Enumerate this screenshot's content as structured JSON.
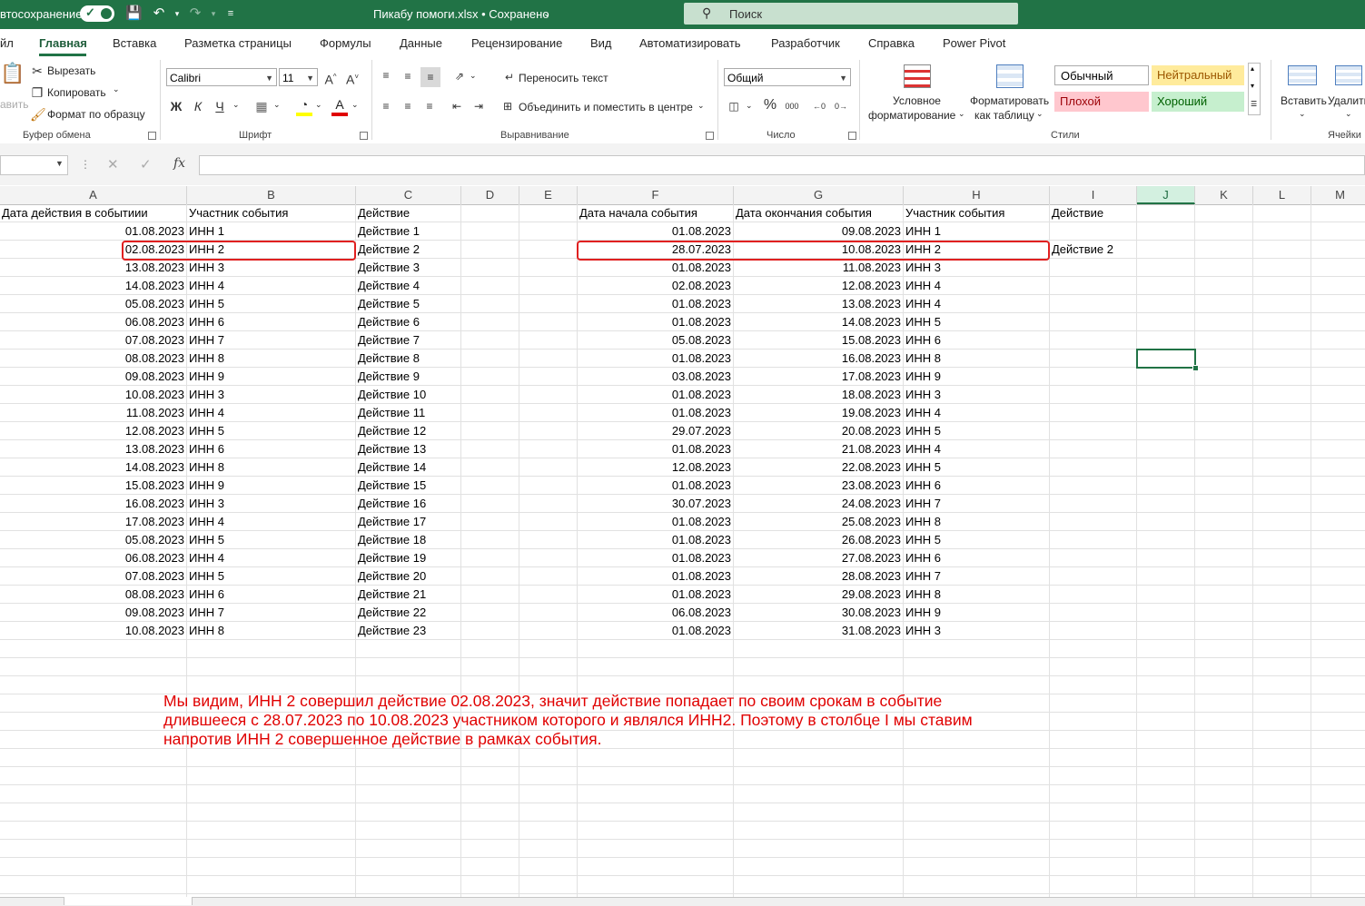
{
  "title_bar": {
    "autosave_label": "втосохранение",
    "file_title": "Пикабу помоги.xlsx • Сохранено",
    "search_placeholder": "Поиск"
  },
  "tabs": [
    "йл",
    "Главная",
    "Вставка",
    "Разметка страницы",
    "Формулы",
    "Данные",
    "Рецензирование",
    "Вид",
    "Автоматизировать",
    "Разработчик",
    "Справка",
    "Power Pivot"
  ],
  "ribbon": {
    "clipboard": {
      "cut": "Вырезать",
      "copy": "Копировать",
      "format_painter": "Формат по образцу",
      "paste_partial": "авить",
      "label": "Буфер обмена"
    },
    "font": {
      "name": "Calibri",
      "size": "11",
      "bold": "Ж",
      "italic": "К",
      "underline": "Ч",
      "label": "Шрифт"
    },
    "alignment": {
      "wrap": "Переносить текст",
      "merge": "Объединить и поместить в центре",
      "label": "Выравнивание"
    },
    "number": {
      "format": "Общий",
      "label": "Число"
    },
    "styles": {
      "conditional": [
        "Условное",
        "форматирование"
      ],
      "as_table": [
        "Форматировать",
        "как таблицу"
      ],
      "normal": "Обычный",
      "neutral": "Нейтральный",
      "bad": "Плохой",
      "good": "Хороший",
      "label": "Стили"
    },
    "cells": {
      "insert": "Вставить",
      "delete": "Удалить",
      "label": "Ячейки"
    }
  },
  "formula_bar": {
    "fx": "fx",
    "value": ""
  },
  "columns": [
    "A",
    "B",
    "C",
    "D",
    "E",
    "F",
    "G",
    "H",
    "I",
    "J",
    "K",
    "L",
    "M"
  ],
  "selected_column": "J",
  "sheet": {
    "headers": {
      "A": "Дата действия в событиии",
      "B": "Участник события",
      "C": "Действие",
      "F": "Дата начала события",
      "G": "Дата окончания события",
      "H": "Участник события",
      "I": "Действие"
    },
    "rows": [
      {
        "A": "01.08.2023",
        "B": "ИНН 1",
        "C": "Действие 1",
        "F": "01.08.2023",
        "G": "09.08.2023",
        "H": "ИНН 1",
        "I": ""
      },
      {
        "A": "02.08.2023",
        "B": "ИНН 2",
        "C": "Действие 2",
        "F": "28.07.2023",
        "G": "10.08.2023",
        "H": "ИНН 2",
        "I": "Действие 2"
      },
      {
        "A": "13.08.2023",
        "B": "ИНН 3",
        "C": "Действие 3",
        "F": "01.08.2023",
        "G": "11.08.2023",
        "H": "ИНН 3",
        "I": ""
      },
      {
        "A": "14.08.2023",
        "B": "ИНН 4",
        "C": "Действие 4",
        "F": "02.08.2023",
        "G": "12.08.2023",
        "H": "ИНН 4",
        "I": ""
      },
      {
        "A": "05.08.2023",
        "B": "ИНН 5",
        "C": "Действие 5",
        "F": "01.08.2023",
        "G": "13.08.2023",
        "H": "ИНН 4",
        "I": ""
      },
      {
        "A": "06.08.2023",
        "B": "ИНН 6",
        "C": "Действие 6",
        "F": "01.08.2023",
        "G": "14.08.2023",
        "H": "ИНН 5",
        "I": ""
      },
      {
        "A": "07.08.2023",
        "B": "ИНН 7",
        "C": "Действие 7",
        "F": "05.08.2023",
        "G": "15.08.2023",
        "H": "ИНН 6",
        "I": ""
      },
      {
        "A": "08.08.2023",
        "B": "ИНН 8",
        "C": "Действие 8",
        "F": "01.08.2023",
        "G": "16.08.2023",
        "H": "ИНН 8",
        "I": ""
      },
      {
        "A": "09.08.2023",
        "B": "ИНН 9",
        "C": "Действие 9",
        "F": "03.08.2023",
        "G": "17.08.2023",
        "H": "ИНН 9",
        "I": ""
      },
      {
        "A": "10.08.2023",
        "B": "ИНН 3",
        "C": "Действие 10",
        "F": "01.08.2023",
        "G": "18.08.2023",
        "H": "ИНН 3",
        "I": ""
      },
      {
        "A": "11.08.2023",
        "B": "ИНН 4",
        "C": "Действие 11",
        "F": "01.08.2023",
        "G": "19.08.2023",
        "H": "ИНН 4",
        "I": ""
      },
      {
        "A": "12.08.2023",
        "B": "ИНН 5",
        "C": "Действие 12",
        "F": "29.07.2023",
        "G": "20.08.2023",
        "H": "ИНН 5",
        "I": ""
      },
      {
        "A": "13.08.2023",
        "B": "ИНН 6",
        "C": "Действие 13",
        "F": "01.08.2023",
        "G": "21.08.2023",
        "H": "ИНН 4",
        "I": ""
      },
      {
        "A": "14.08.2023",
        "B": "ИНН 8",
        "C": "Действие 14",
        "F": "12.08.2023",
        "G": "22.08.2023",
        "H": "ИНН 5",
        "I": ""
      },
      {
        "A": "15.08.2023",
        "B": "ИНН 9",
        "C": "Действие 15",
        "F": "01.08.2023",
        "G": "23.08.2023",
        "H": "ИНН 6",
        "I": ""
      },
      {
        "A": "16.08.2023",
        "B": "ИНН 3",
        "C": "Действие 16",
        "F": "30.07.2023",
        "G": "24.08.2023",
        "H": "ИНН 7",
        "I": ""
      },
      {
        "A": "17.08.2023",
        "B": "ИНН 4",
        "C": "Действие 17",
        "F": "01.08.2023",
        "G": "25.08.2023",
        "H": "ИНН 8",
        "I": ""
      },
      {
        "A": "05.08.2023",
        "B": "ИНН 5",
        "C": "Действие 18",
        "F": "01.08.2023",
        "G": "26.08.2023",
        "H": "ИНН 5",
        "I": ""
      },
      {
        "A": "06.08.2023",
        "B": "ИНН 4",
        "C": "Действие 19",
        "F": "01.08.2023",
        "G": "27.08.2023",
        "H": "ИНН 6",
        "I": ""
      },
      {
        "A": "07.08.2023",
        "B": "ИНН 5",
        "C": "Действие 20",
        "F": "01.08.2023",
        "G": "28.08.2023",
        "H": "ИНН 7",
        "I": ""
      },
      {
        "A": "08.08.2023",
        "B": "ИНН 6",
        "C": "Действие 21",
        "F": "01.08.2023",
        "G": "29.08.2023",
        "H": "ИНН 8",
        "I": ""
      },
      {
        "A": "09.08.2023",
        "B": "ИНН 7",
        "C": "Действие 22",
        "F": "06.08.2023",
        "G": "30.08.2023",
        "H": "ИНН 9",
        "I": ""
      },
      {
        "A": "10.08.2023",
        "B": "ИНН 8",
        "C": "Действие 23",
        "F": "01.08.2023",
        "G": "31.08.2023",
        "H": "ИНН 3",
        "I": ""
      }
    ]
  },
  "note": [
    "Мы видим, ИНН 2 совершил действие 02.08.2023, значит действие попадает по своим срокам в событие",
    "длившееся с 28.07.2023 по 10.08.2023 участником которого и являлся ИНН2. Поэтому в столбце I мы ставим",
    "напротив ИНН 2 совершенное действие в рамках события."
  ],
  "colors": {
    "excel_green": "#217346",
    "annotation_red": "#e00000",
    "neutral_bg": "#ffeb9c",
    "bad_bg": "#ffc7ce",
    "good_bg": "#c6efce"
  }
}
